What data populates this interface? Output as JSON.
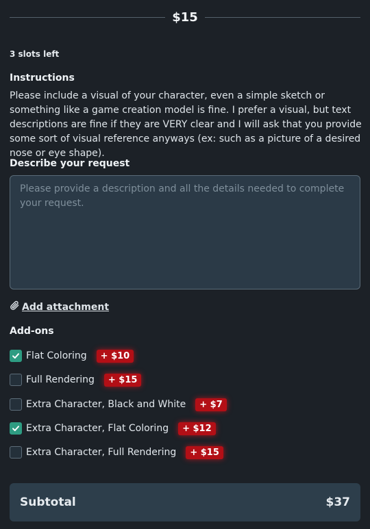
{
  "header": {
    "price": "$15"
  },
  "slots": "3 slots left",
  "instructions": {
    "title": "Instructions",
    "text": "Please include a visual of your character, even a simple sketch or something like a game creation model is fine. I prefer a visual, but text descriptions are fine if they are VERY clear and I will ask that you provide some sort of visual reference anyways (ex: such as a picture of a desired nose or eye shape)."
  },
  "request": {
    "title": "Describe your request",
    "placeholder": "Please provide a description and all the details needed to complete your request.",
    "value": ""
  },
  "attachment": {
    "label": "Add attachment",
    "icon": "paperclip-icon"
  },
  "addons": {
    "title": "Add-ons",
    "items": [
      {
        "label": "Flat Coloring",
        "price": "+ $10",
        "checked": true
      },
      {
        "label": "Full Rendering",
        "price": "+ $15",
        "checked": false
      },
      {
        "label": "Extra Character, Black and White",
        "price": "+ $7",
        "checked": false
      },
      {
        "label": "Extra Character, Flat Coloring",
        "price": "+ $12",
        "checked": true
      },
      {
        "label": "Extra Character, Full Rendering",
        "price": "+ $15",
        "checked": false
      }
    ]
  },
  "subtotal": {
    "label": "Subtotal",
    "amount": "$37"
  },
  "colors": {
    "background": "#1c2127",
    "input_background": "#2b3a47",
    "checkbox_checked": "#2e9c82",
    "price_badge": "#b30f16",
    "subtotal_background": "#2d3e4b"
  }
}
